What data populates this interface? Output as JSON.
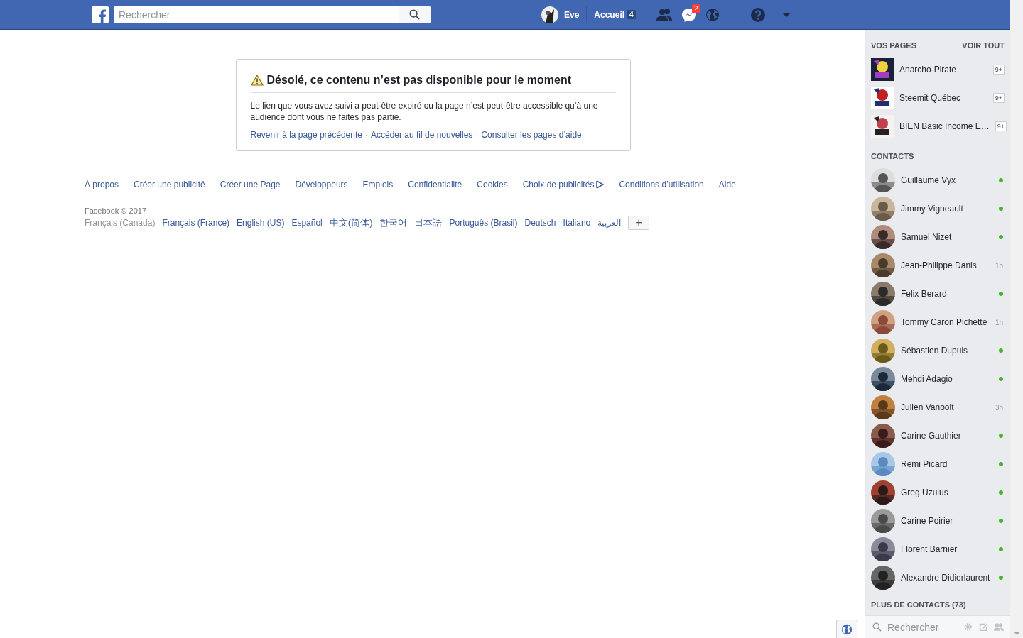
{
  "top_bar": {
    "search": {
      "placeholder": "Rechercher"
    },
    "user": {
      "name": "Eve"
    },
    "home": {
      "label": "Accueil",
      "count": "4"
    },
    "messages_badge": "2"
  },
  "error_box": {
    "title": "Désolé, ce contenu n’est pas disponible pour le moment",
    "body": "Le lien que vous avez suivi a peut-être expiré ou la page n’est peut-être accessible qu’à une audience dont vous ne faites pas partie.",
    "links": [
      "Revenir à la page précédente",
      "Accéder au fil de nouvelles",
      "Consulter les pages d’aide"
    ],
    "separator": "·"
  },
  "footer": {
    "links": [
      {
        "label": "À propos"
      },
      {
        "label": "Créer une publicité"
      },
      {
        "label": "Créer une Page"
      },
      {
        "label": "Développeurs"
      },
      {
        "label": "Emplois"
      },
      {
        "label": "Confidentialité"
      },
      {
        "label": "Cookies"
      },
      {
        "label": "Choix de publicités",
        "kind": "adchoices"
      },
      {
        "label": "Conditions d’utilisation"
      },
      {
        "label": "Aide"
      }
    ],
    "copyright": "Facebook © 2017",
    "languages": [
      {
        "label": "Français (Canada)",
        "selected": true
      },
      {
        "label": "Français (France)",
        "selected": false
      },
      {
        "label": "English (US)",
        "selected": false
      },
      {
        "label": "Español",
        "selected": false
      },
      {
        "label": "中文(简体)",
        "selected": false
      },
      {
        "label": "한국어",
        "selected": false
      },
      {
        "label": "日本語",
        "selected": false
      },
      {
        "label": "Português (Brasil)",
        "selected": false
      },
      {
        "label": "Deutsch",
        "selected": false
      },
      {
        "label": "Italiano",
        "selected": false
      },
      {
        "label": "العربية",
        "selected": false
      }
    ],
    "more_button": "+"
  },
  "sidebar": {
    "pages_heading": "VOS PAGES",
    "see_all": "VOIR TOUT",
    "pages": [
      {
        "name": "Anarcho-Pirate",
        "badge": "9+"
      },
      {
        "name": "Steemit Québec",
        "badge": "9+"
      },
      {
        "name": "BIEN Basic Income E…",
        "badge": "9+"
      }
    ],
    "contacts_heading": "CONTACTS",
    "contacts": [
      {
        "name": "Guillaume Vyx",
        "kind": "online"
      },
      {
        "name": "Jimmy Vigneault",
        "kind": "online"
      },
      {
        "name": "Samuel Nizet",
        "kind": "online"
      },
      {
        "name": "Jean-Philippe Danis",
        "kind": "idle",
        "time": "1h"
      },
      {
        "name": "Felix Berard",
        "kind": "online"
      },
      {
        "name": "Tommy Caron Pichette",
        "kind": "idle",
        "time": "1h"
      },
      {
        "name": "Sébastien Dupuis",
        "kind": "online"
      },
      {
        "name": "Mehdi Adagio",
        "kind": "online"
      },
      {
        "name": "Julien Vanooit",
        "kind": "idle",
        "time": "3h"
      },
      {
        "name": "Carine Gauthier",
        "kind": "online"
      },
      {
        "name": "Rémi Picard",
        "kind": "online"
      },
      {
        "name": "Greg Uzulus",
        "kind": "online"
      },
      {
        "name": "Carine Poirier",
        "kind": "online"
      },
      {
        "name": "Florent Barnier",
        "kind": "online"
      },
      {
        "name": "Alexandre Didierlaurent",
        "kind": "online"
      }
    ],
    "more_contacts": "PLUS DE CONTACTS (73)",
    "search": {
      "placeholder": "Rechercher"
    }
  }
}
